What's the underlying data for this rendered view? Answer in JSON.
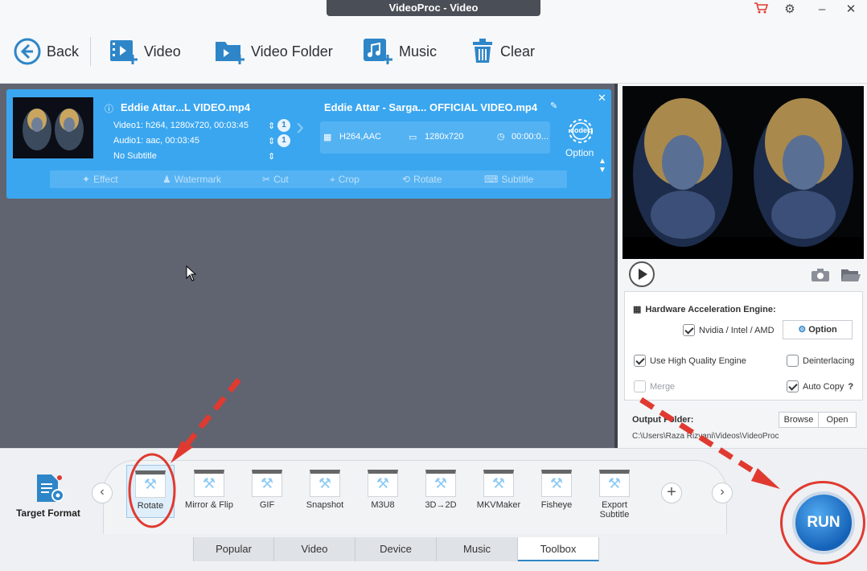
{
  "window": {
    "title": "VideoProc - Video"
  },
  "toolbar": {
    "back": "Back",
    "video": "Video",
    "video_folder": "Video Folder",
    "music": "Music",
    "clear": "Clear"
  },
  "file_card": {
    "source_name": "Eddie Attar...L VIDEO.mp4",
    "video_track": "Video1: h264, 1280x720, 00:03:45",
    "audio_track": "Audio1: aac, 00:03:45",
    "subtitle": "No Subtitle",
    "video_count": "1",
    "audio_count": "1",
    "output_name": "Eddie Attar - Sarga... OFFICIAL VIDEO.mp4",
    "output_codec": "H264,AAC",
    "output_resolution": "1280x720",
    "output_duration": "00:00:0...",
    "codec_label": "codec",
    "option_label": "Option",
    "edit_tools": [
      "Effect",
      "Watermark",
      "Cut",
      "Crop",
      "Rotate",
      "Subtitle"
    ]
  },
  "settings": {
    "hw_title": "Hardware Acceleration Engine:",
    "hw_vendor": "Nvidia / Intel / AMD",
    "hw_vendor_checked": true,
    "option_button": "Option",
    "high_quality": "Use High Quality Engine",
    "high_quality_checked": true,
    "deinterlacing": "Deinterlacing",
    "deinterlacing_checked": false,
    "merge": "Merge",
    "merge_checked": false,
    "auto_copy": "Auto Copy",
    "auto_copy_checked": true,
    "help_mark": "?",
    "output_folder_label": "Output Folder:",
    "output_path": "C:\\Users\\Raza Rizvani\\Videos\\VideoProc",
    "browse": "Browse",
    "open": "Open"
  },
  "format_bar": {
    "target_format": "Target Format",
    "items": [
      "Rotate",
      "Mirror & Flip",
      "GIF",
      "Snapshot",
      "M3U8",
      "3D→2D",
      "MKVMaker",
      "Fisheye",
      "Export Subtitle"
    ],
    "selected": "Rotate"
  },
  "tabs": [
    "Popular",
    "Video",
    "Device",
    "Music",
    "Toolbox"
  ],
  "active_tab": "Toolbox",
  "run_label": "RUN",
  "colors": {
    "accent": "#3aa6ef",
    "annotation": "#e03a30"
  }
}
